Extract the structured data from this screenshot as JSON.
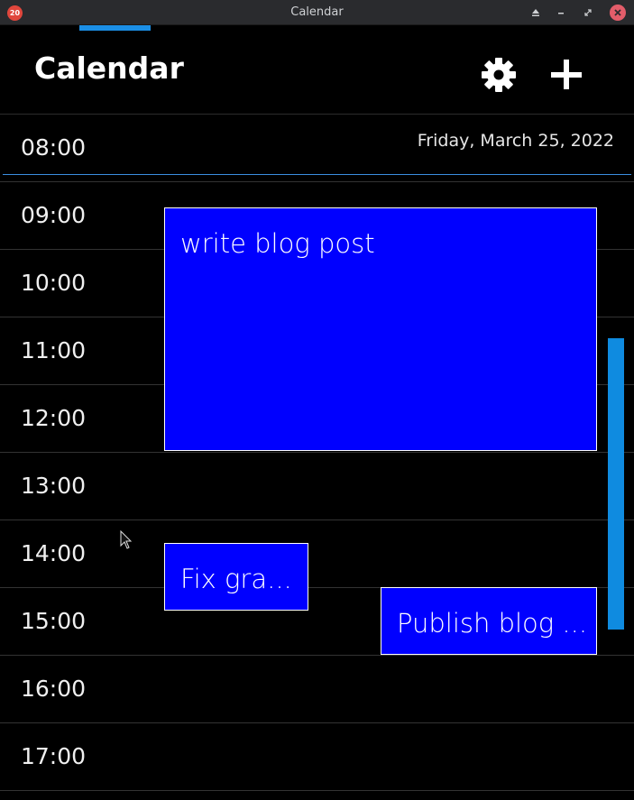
{
  "window": {
    "title": "Calendar",
    "badge": "20"
  },
  "header": {
    "title": "Calendar"
  },
  "date": "Friday, March 25, 2022",
  "hours": [
    "08:00",
    "09:00",
    "10:00",
    "11:00",
    "12:00",
    "13:00",
    "14:00",
    "15:00",
    "16:00",
    "17:00"
  ],
  "events": [
    {
      "title": "write blog post"
    },
    {
      "title": "Fix gra..."
    },
    {
      "title": "Publish blog ..."
    }
  ],
  "colors": {
    "event_bg": "#0000ff",
    "accent": "#1b8fe6",
    "background": "#000000"
  }
}
